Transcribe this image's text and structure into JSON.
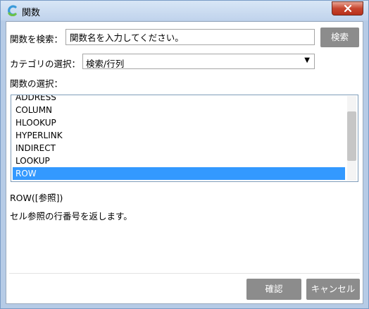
{
  "window": {
    "title": "関数",
    "app_icon": "app-logo-icon",
    "close_icon": "close-icon"
  },
  "search": {
    "label": "関数を検索：",
    "value": "関数名を入力してください。",
    "button_label": "検索"
  },
  "category": {
    "label": "カテゴリの選択：",
    "selected": "検索/行列",
    "arrow": "▼"
  },
  "function_list": {
    "label": "関数の選択：",
    "items": [
      "ADDRESS",
      "COLUMN",
      "HLOOKUP",
      "HYPERLINK",
      "INDIRECT",
      "LOOKUP",
      "ROW"
    ],
    "selected_item": "ROW"
  },
  "details": {
    "syntax": "ROW([参照])",
    "description": "セル参照の行番号を返します。"
  },
  "footer": {
    "confirm_label": "確認",
    "cancel_label": "キャンセル"
  },
  "colors": {
    "selection": "#3399ff",
    "button": "#8c8c8c",
    "close": "#c7462f"
  }
}
